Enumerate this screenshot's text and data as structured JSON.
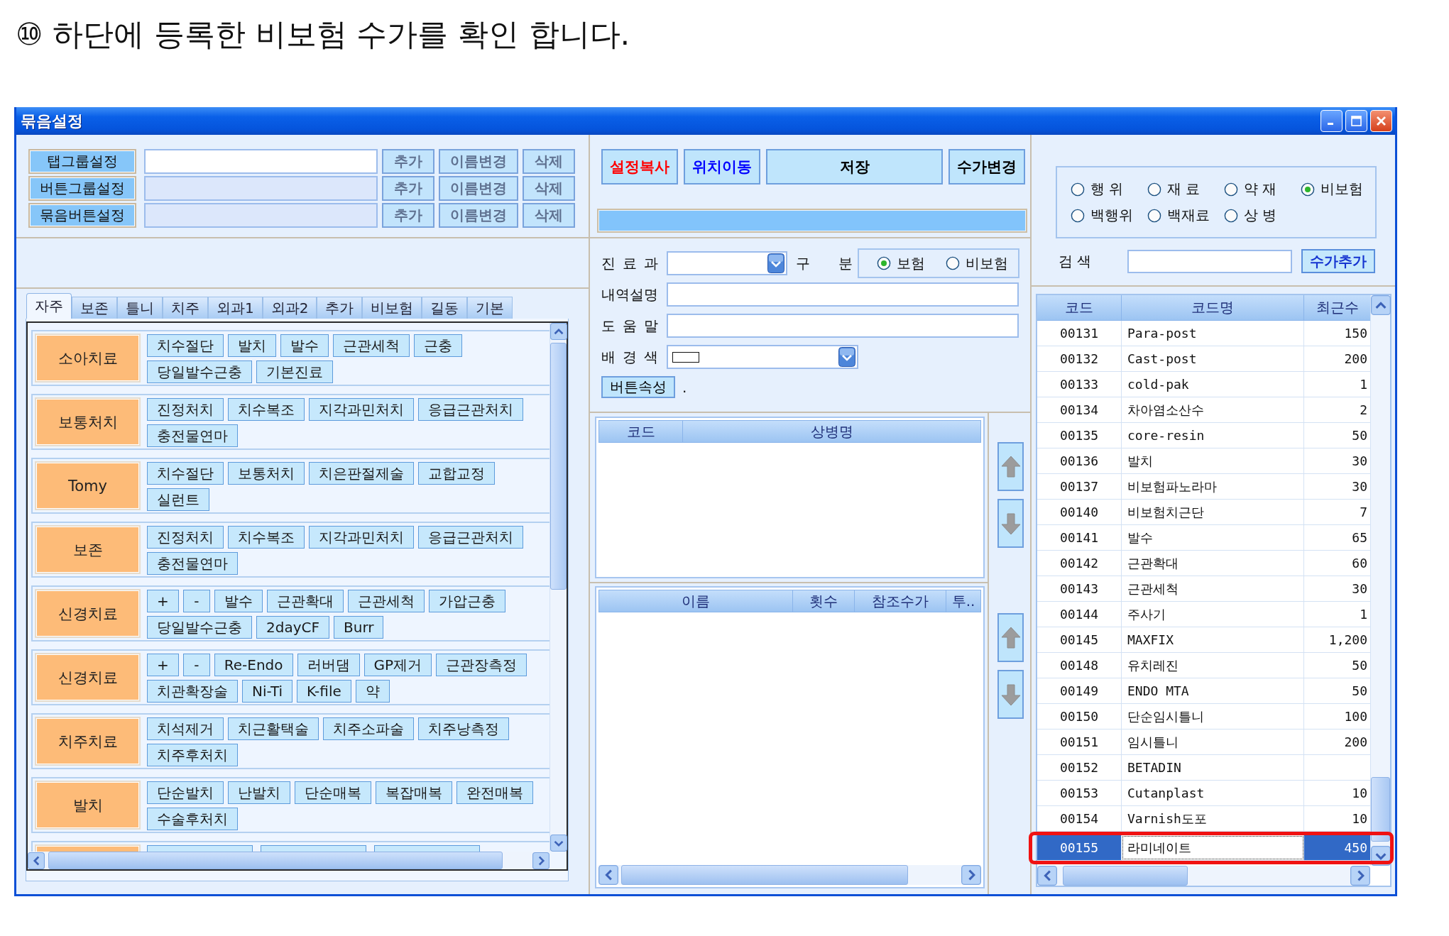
{
  "instruction": "⑩ 하단에 등록한 비보험 수가를 확인 합니다.",
  "window": {
    "title": "묶음설정"
  },
  "settings_rows": [
    {
      "label": "탭그룹설정",
      "field": {
        "disabled": false
      },
      "buttons": [
        {
          "label": "추가",
          "disabled": true
        },
        {
          "label": "이름변경",
          "disabled": true
        },
        {
          "label": "삭제",
          "disabled": true
        }
      ]
    },
    {
      "label": "버튼그룹설정",
      "field": {
        "disabled": true
      },
      "buttons": [
        {
          "label": "추가",
          "disabled": true
        },
        {
          "label": "이름변경",
          "disabled": true
        },
        {
          "label": "삭제",
          "disabled": true
        }
      ]
    },
    {
      "label": "묶음버튼설정",
      "field": {
        "disabled": true
      },
      "buttons": [
        {
          "label": "추가",
          "disabled": true
        },
        {
          "label": "이름변경",
          "disabled": true
        },
        {
          "label": "삭제",
          "disabled": true
        }
      ]
    }
  ],
  "tabs": [
    {
      "label": "자주",
      "selected": true
    },
    {
      "label": "보존",
      "selected": false
    },
    {
      "label": "틀니",
      "selected": false
    },
    {
      "label": "치주",
      "selected": false
    },
    {
      "label": "외과1",
      "selected": false
    },
    {
      "label": "외과2",
      "selected": false
    },
    {
      "label": "추가",
      "selected": false
    },
    {
      "label": "비보험",
      "selected": false
    },
    {
      "label": "길동",
      "selected": false
    },
    {
      "label": "기본",
      "selected": false
    }
  ],
  "groups": [
    {
      "kind": "full",
      "label": "소아치료",
      "buttons": [
        "치수절단",
        "발치",
        "발수",
        "근관세척",
        "근충",
        "당일발수근충",
        "기본진료"
      ]
    },
    {
      "kind": "full",
      "label": "보통처치",
      "buttons": [
        "진정처치",
        "치수복조",
        "지각과민처치",
        "응급근관처치",
        "충전물연마"
      ]
    },
    {
      "kind": "full",
      "label": "Tomy",
      "buttons": [
        "치수절단",
        "보통처치",
        "치은판절제술",
        "교합교정",
        "실런트"
      ]
    },
    {
      "kind": "full",
      "label": "보존",
      "buttons": [
        "진정처치",
        "치수복조",
        "지각과민처치",
        "응급근관처치",
        "충전물연마"
      ]
    },
    {
      "kind": "full",
      "label": "신경치료",
      "buttons": [
        "+",
        "-",
        "발수",
        "근관확대",
        "근관세척",
        "가압근충",
        "당일발수근충",
        "2dayCF",
        "Burr"
      ]
    },
    {
      "kind": "full",
      "label": "신경치료",
      "buttons": [
        "+",
        "-",
        "Re-Endo",
        "러버댐",
        "GP제거",
        "근관장측정",
        "치관확장술",
        "Ni-Ti",
        "K-file",
        "약"
      ]
    },
    {
      "kind": "full",
      "label": "치주치료",
      "buttons": [
        "치석제거",
        "치근활택술",
        "치주소파술",
        "치주낭측정",
        "치주후처치"
      ]
    },
    {
      "kind": "full",
      "label": "발치",
      "buttons": [
        "단순발치",
        "난발치",
        "단순매복",
        "복잡매복",
        "완전매복",
        "수술후처치"
      ]
    },
    {
      "kind": "clipped"
    }
  ],
  "action_buttons": [
    {
      "label": "설정복사",
      "color": "#ff0000"
    },
    {
      "label": "위치이동",
      "color": "#0000ff"
    },
    {
      "label": "저장",
      "color": "#000000"
    },
    {
      "label": "수가변경",
      "color": "#000000"
    }
  ],
  "form": {
    "department": {
      "label": "진 료 과"
    },
    "category": {
      "label": "구 분",
      "options": [
        {
          "label": "보험",
          "selected": true
        },
        {
          "label": "비보험",
          "selected": false
        }
      ]
    },
    "description": {
      "label": "내역설명"
    },
    "help": {
      "label": "도 움 말"
    },
    "background": {
      "label": "배 경 색"
    },
    "button_properties": {
      "label": "버튼속성",
      "value": "."
    }
  },
  "diagnosis_grid": {
    "columns": [
      "코드",
      "상병명"
    ]
  },
  "item_grid": {
    "columns": [
      "이름",
      "횟수",
      "참조수가",
      "투.."
    ]
  },
  "type_filter": {
    "options": [
      {
        "label": "행 위",
        "selected": false
      },
      {
        "label": "재 료",
        "selected": false
      },
      {
        "label": "약 재",
        "selected": false
      },
      {
        "label": "비보험",
        "selected": true
      },
      {
        "label": "백행위",
        "selected": false
      },
      {
        "label": "백재료",
        "selected": false
      },
      {
        "label": "상 병",
        "selected": false
      }
    ]
  },
  "search": {
    "label": "검 색",
    "button": "수가추가"
  },
  "fee_table": {
    "columns": [
      "코드",
      "코드명",
      "최근수"
    ],
    "rows": [
      {
        "code": "00131",
        "name": "Para-post",
        "price": "150",
        "selected": false,
        "highlighted": false
      },
      {
        "code": "00132",
        "name": "Cast-post",
        "price": "200",
        "selected": false,
        "highlighted": false
      },
      {
        "code": "00133",
        "name": "cold-pak",
        "price": "1",
        "selected": false,
        "highlighted": false
      },
      {
        "code": "00134",
        "name": "차아염소산수",
        "price": "2",
        "selected": false,
        "highlighted": false
      },
      {
        "code": "00135",
        "name": "core-resin",
        "price": "50",
        "selected": false,
        "highlighted": false
      },
      {
        "code": "00136",
        "name": "발치",
        "price": "30",
        "selected": false,
        "highlighted": false
      },
      {
        "code": "00137",
        "name": "비보험파노라마",
        "price": "30",
        "selected": false,
        "highlighted": false
      },
      {
        "code": "00140",
        "name": "비보험치근단",
        "price": "7",
        "selected": false,
        "highlighted": false
      },
      {
        "code": "00141",
        "name": "발수",
        "price": "65",
        "selected": false,
        "highlighted": false
      },
      {
        "code": "00142",
        "name": "근관확대",
        "price": "60",
        "selected": false,
        "highlighted": false
      },
      {
        "code": "00143",
        "name": "근관세척",
        "price": "30",
        "selected": false,
        "highlighted": false
      },
      {
        "code": "00144",
        "name": "주사기",
        "price": "1",
        "selected": false,
        "highlighted": false
      },
      {
        "code": "00145",
        "name": "MAXFIX",
        "price": "1,200",
        "selected": false,
        "highlighted": false
      },
      {
        "code": "00148",
        "name": "유치레진",
        "price": "50",
        "selected": false,
        "highlighted": false
      },
      {
        "code": "00149",
        "name": "ENDO MTA",
        "price": "50",
        "selected": false,
        "highlighted": false
      },
      {
        "code": "00150",
        "name": "단순임시틀니",
        "price": "100",
        "selected": false,
        "highlighted": false
      },
      {
        "code": "00151",
        "name": "임시틀니",
        "price": "200",
        "selected": false,
        "highlighted": false
      },
      {
        "code": "00152",
        "name": "BETADIN",
        "selected": false,
        "highlighted": false
      },
      {
        "code": "00153",
        "name": "Cutanplast",
        "price": "10",
        "selected": false,
        "highlighted": false
      },
      {
        "code": "00154",
        "name": "Varnish도포",
        "price": "10",
        "selected": false,
        "highlighted": false
      },
      {
        "code": "00155",
        "name": "라미네이트",
        "price": "450",
        "selected": true,
        "highlighted": true
      }
    ]
  }
}
